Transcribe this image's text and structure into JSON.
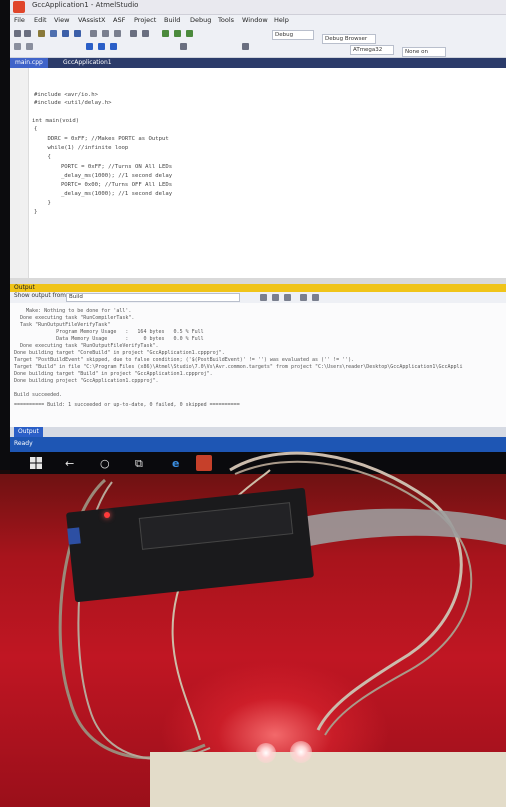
{
  "window": {
    "title": "GccApplication1 - AtmelStudio"
  },
  "menu": [
    "File",
    "Edit",
    "View",
    "VAssistX",
    "ASF",
    "Project",
    "Build",
    "Debug",
    "Tools",
    "Window",
    "Help"
  ],
  "toolbar": {
    "config": "Debug",
    "platform": "Debug Browser",
    "device": "ATmega32",
    "tool": "None on"
  },
  "tabs": [
    {
      "label": "main.cpp"
    },
    {
      "label": "GccApplication1"
    }
  ],
  "code": [
    "#include <avr/io.h>",
    "#include <util/delay.h>",
    "",
    "int main(void)",
    "{",
    "    DDRC = 0xFF; //Makes PORTC as Output",
    "    while(1) //infinite loop",
    "    {",
    "        PORTC = 0xFF; //Turns ON All LEDs",
    "        _delay_ms(1000); //1 second delay",
    "        PORTC= 0x00; //Turns OFF All LEDs",
    "        _delay_ms(1000); //1 second delay",
    "    }",
    "}"
  ],
  "output_panel": {
    "title": "Output",
    "show_from_label": "Show output from:",
    "show_from_value": "Build",
    "lines": [
      "    Make: Nothing to be done for 'all'.",
      "  Done executing task \"RunCompilerTask\".",
      "  Task \"RunOutputFileVerifyTask\"",
      "              Program Memory Usage   :   164 bytes   0.5 % Full",
      "              Data Memory Usage      :     0 bytes   0.0 % Full",
      "  Done executing task \"RunOutputFileVerifyTask\".",
      "Done building target \"CoreBuild\" in project \"GccApplication1.cppproj\".",
      "Target \"PostBuildEvent\" skipped, due to false condition; ('$(PostBuildEvent)' != '') was evaluated as ('' != '').",
      "Target \"Build\" in file \"C:\\Program Files (x86)\\Atmel\\Studio\\7.0\\Vs\\Avr.common.targets\" from project \"C:\\Users\\reader\\Desktop\\GccApplication1\\GccAppli",
      "Done building target \"Build\" in project \"GccApplication1.cppproj\".",
      "Done building project \"GccApplication1.cppproj\".",
      "",
      "Build succeeded.",
      "========== Build: 1 succeeded or up-to-date, 0 failed, 0 skipped =========="
    ],
    "bottom_tab": "Output"
  },
  "status": {
    "text": "Ready"
  },
  "colors": {
    "accent": "#f0c419",
    "status_bar": "#1e56b4",
    "desk": "#c01623"
  }
}
